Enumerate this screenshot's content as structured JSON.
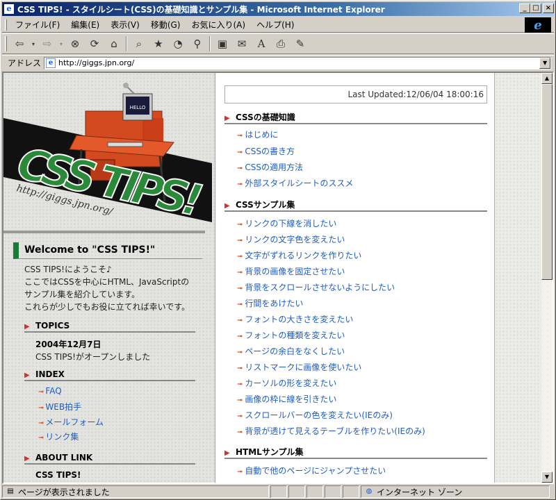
{
  "window": {
    "title": "CSS TIPS! - スタイルシート(CSS)の基礎知識とサンプル集 - Microsoft Internet Explorer"
  },
  "menu": [
    "ファイル(F)",
    "編集(E)",
    "表示(V)",
    "移動(G)",
    "お気に入り(A)",
    "ヘルプ(H)"
  ],
  "toolbar": [
    "back-icon",
    "forward-icon",
    "stop-icon",
    "refresh-icon",
    "home-icon",
    "search-icon",
    "favorites-icon",
    "history-icon",
    "channels-icon",
    "fullscreen-icon",
    "mail-icon",
    "font-icon",
    "print-icon",
    "edit-icon"
  ],
  "address": {
    "label": "アドレス",
    "url": "http://giggs.jpn.org/"
  },
  "logo": {
    "text": "CSS TIPS!",
    "url_text": "http://giggs.jpn.org/",
    "monitor_text": "HELLO"
  },
  "welcome": {
    "heading": "Welcome to \"CSS TIPS!\"",
    "lines": [
      "CSS TIPS!にようこそ♪",
      "ここではCSSを中心にHTML、JavaScriptの",
      "サンプル集を紹介しています。",
      "これらが少しでもお役に立てれば幸いです。"
    ]
  },
  "topics": {
    "heading": "TOPICS",
    "date": "2004年12月7日",
    "text": "CSS TIPS!がオープンしました"
  },
  "index": {
    "heading": "INDEX",
    "items": [
      "FAQ",
      "WEB拍手",
      "メールフォーム",
      "リンク集"
    ]
  },
  "about": {
    "heading": "ABOUT LINK",
    "text": "CSS TIPS!"
  },
  "last_updated": "Last Updated:12/06/04 18:00:16",
  "basics": {
    "heading": "CSSの基礎知識",
    "items": [
      "はじめに",
      "CSSの書き方",
      "CSSの適用方法",
      "外部スタイルシートのススメ"
    ]
  },
  "css_samples": {
    "heading": "CSSサンプル集",
    "items": [
      "リンクの下線を消したい",
      "リンクの文字色を変えたい",
      "文字がずれるリンクを作りたい",
      "背景の画像を固定させたい",
      "背景をスクロールさせないようにしたい",
      "行間をあけたい",
      "フォントの大きさを変えたい",
      "フォントの種類を変えたい",
      "ページの余白をなくしたい",
      "リストマークに画像を使いたい",
      "カーソルの形を変えたい",
      "画像の枠に線を引きたい",
      "スクロールバーの色を変えたい(IEのみ)",
      "背景が透けて見えるテーブルを作りたい(IEのみ)"
    ]
  },
  "html_samples": {
    "heading": "HTMLサンプル集",
    "items": [
      "自動で他のページにジャンプさせたい"
    ]
  },
  "status": {
    "text": "ページが表示されました",
    "zone": "インターネット ゾーン"
  }
}
